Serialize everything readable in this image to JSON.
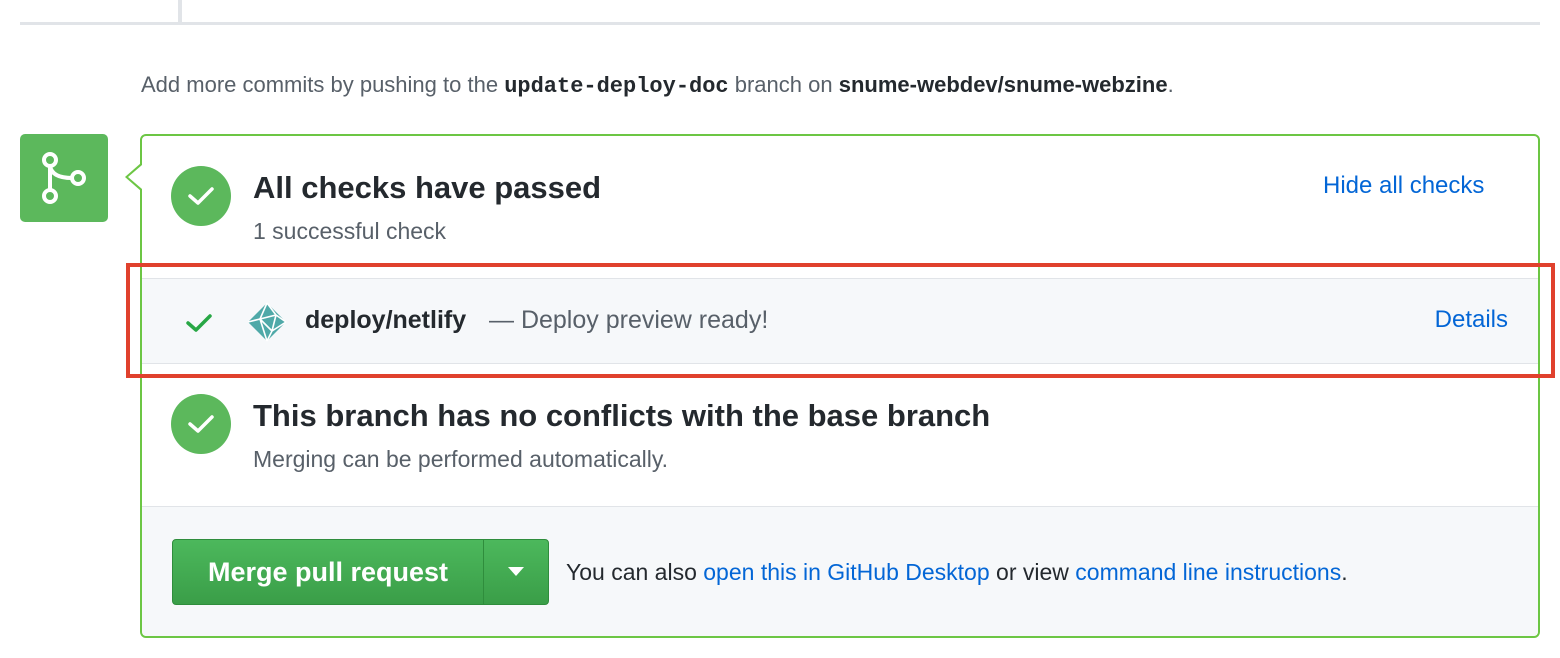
{
  "push_note": {
    "prefix": "Add more commits by pushing to the",
    "branch": "update-deploy-doc",
    "middle": "branch on",
    "repo": "snume-webdev/snume-webzine",
    "suffix": "."
  },
  "checks": {
    "title": "All checks have passed",
    "subtitle": "1 successful check",
    "toggle_link": "Hide all checks",
    "items": [
      {
        "name": "deploy/netlify",
        "description": "— Deploy preview ready!",
        "details_link": "Details",
        "status": "success"
      }
    ]
  },
  "conflicts": {
    "title": "This branch has no conflicts with the base branch",
    "subtitle": "Merging can be performed automatically."
  },
  "merge": {
    "button_label": "Merge pull request",
    "also_prefix": "You can also",
    "desktop_link": "open this in GitHub Desktop",
    "also_middle": "or view",
    "cli_link": "command line instructions",
    "also_suffix": "."
  },
  "colors": {
    "success_green": "#5cb85c",
    "link_blue": "#0366d6",
    "highlight_red": "#e0412d"
  }
}
